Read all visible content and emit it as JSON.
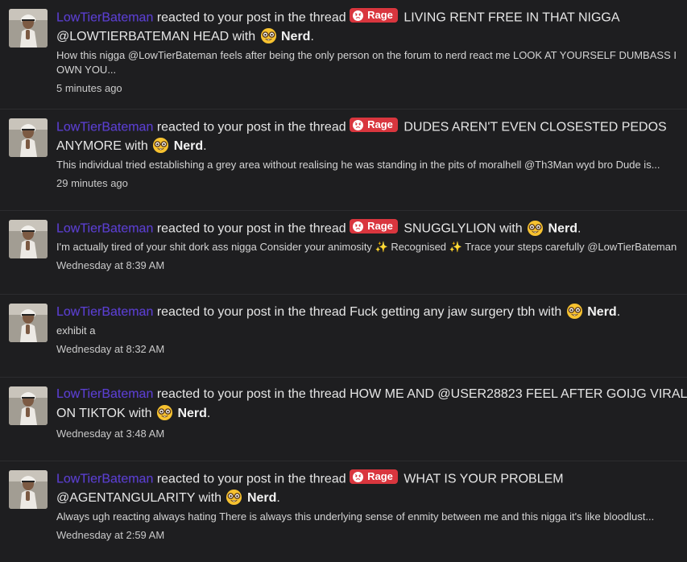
{
  "alerts": [
    {
      "username": "LowTierBateman",
      "action_text": "reacted to your post in the thread",
      "prefix": "Rage",
      "thread_title": "LIVING RENT FREE IN THAT NIGGA @LOWTIERBATEMAN HEAD",
      "with_text": "with",
      "reaction": "Nerd",
      "snippet": "How this nigga @LowTierBateman feels after being the only person on the forum to nerd react me LOOK AT YOURSELF DUMBASS I OWN YOU...",
      "time": "5 minutes ago"
    },
    {
      "username": "LowTierBateman",
      "action_text": "reacted to your post in the thread",
      "prefix": "Rage",
      "thread_title": "DUDES AREN'T EVEN CLOSESTED PEDOS ANYMORE",
      "with_text": "with",
      "reaction": "Nerd",
      "snippet": "This individual tried establishing a grey area without realising he was standing in the pits of moralhell @Th3Man wyd bro Dude is...",
      "time": "29 minutes ago"
    },
    {
      "username": "LowTierBateman",
      "action_text": "reacted to your post in the thread",
      "prefix": "Rage",
      "thread_title": "SNUGGLYLION",
      "with_text": "with",
      "reaction": "Nerd",
      "snippet_parts": [
        "I'm actually tired of your shit dork ass nigga Consider your animosity",
        "Recognised",
        "Trace your steps carefully @LowTierBateman"
      ],
      "sparkle": "✨",
      "time": "Wednesday at 8:39 AM"
    },
    {
      "username": "LowTierBateman",
      "action_text": "reacted to your post in the thread",
      "thread_title": "Fuck getting any jaw surgery tbh",
      "with_text": "with",
      "reaction": "Nerd",
      "snippet": "exhibit a",
      "time": "Wednesday at 8:32 AM"
    },
    {
      "username": "LowTierBateman",
      "action_text": "reacted to your post in the thread",
      "thread_title": "HOW ME AND @USER28823 FEEL AFTER GOIJG VIRAL ON TIKTOK",
      "with_text": "with",
      "reaction": "Nerd",
      "snippet": "",
      "time": "Wednesday at 3:48 AM"
    },
    {
      "username": "LowTierBateman",
      "action_text": "reacted to your post in the thread",
      "prefix": "Rage",
      "thread_title": "WHAT IS YOUR PROBLEM @AGENTANGULARITY",
      "with_text": "with",
      "reaction": "Nerd",
      "snippet": "Always ugh reacting always hating There is always this underlying sense of enmity between me and this nigga it's like bloodlust...",
      "time": "Wednesday at 2:59 AM"
    }
  ],
  "icons": {
    "avatar": "avatar-photo",
    "rage": "angry-face-icon",
    "nerd": "nerd-face-icon",
    "sparkle": "sparkles-icon"
  },
  "colors": {
    "background": "#1e1e20",
    "username": "#5b3fd0",
    "rage_badge": "#d9363e",
    "divider": "#2c2c2f"
  }
}
